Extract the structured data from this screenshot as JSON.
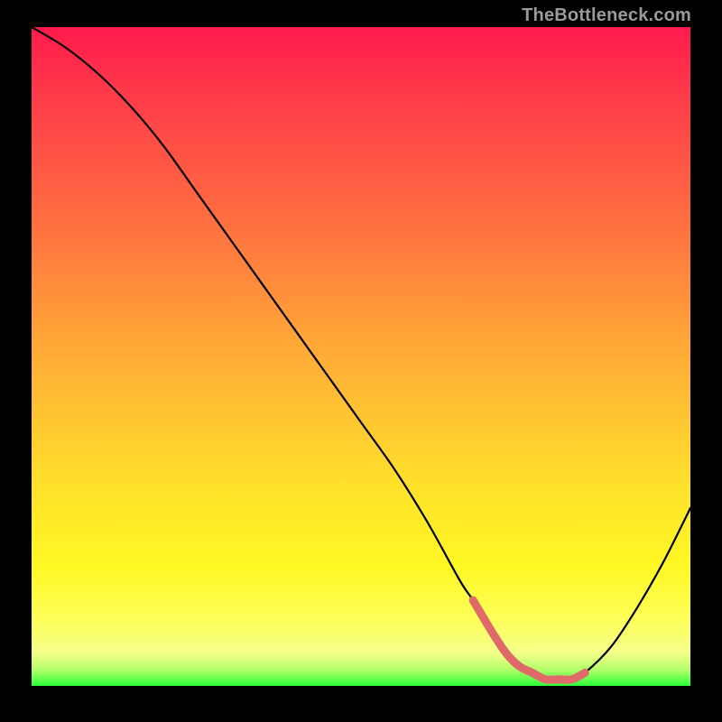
{
  "watermark": "TheBottleneck.com",
  "colors": {
    "curve": "#000000",
    "highlight": "#e06a6a",
    "frame": "#000000"
  },
  "chart_data": {
    "type": "line",
    "title": "",
    "xlabel": "",
    "ylabel": "",
    "xlim": [
      0,
      100
    ],
    "ylim": [
      0,
      100
    ],
    "series": [
      {
        "name": "bottleneck-curve",
        "x": [
          0,
          5,
          10,
          15,
          20,
          25,
          30,
          35,
          40,
          45,
          50,
          55,
          60,
          65,
          67,
          70,
          72,
          74,
          76,
          78,
          80,
          82,
          84,
          88,
          92,
          96,
          100
        ],
        "values": [
          100,
          97,
          93,
          88,
          82,
          75,
          68,
          61,
          54,
          47,
          40,
          33,
          25,
          16,
          13,
          8,
          5,
          3,
          2,
          1,
          1,
          1,
          2,
          6,
          12,
          19,
          27
        ]
      },
      {
        "name": "flat-bottom-highlight",
        "x": [
          67,
          70,
          72,
          74,
          76,
          78,
          80,
          82,
          84
        ],
        "values": [
          13,
          8,
          5,
          3,
          2,
          1,
          1,
          1,
          2
        ]
      }
    ]
  }
}
